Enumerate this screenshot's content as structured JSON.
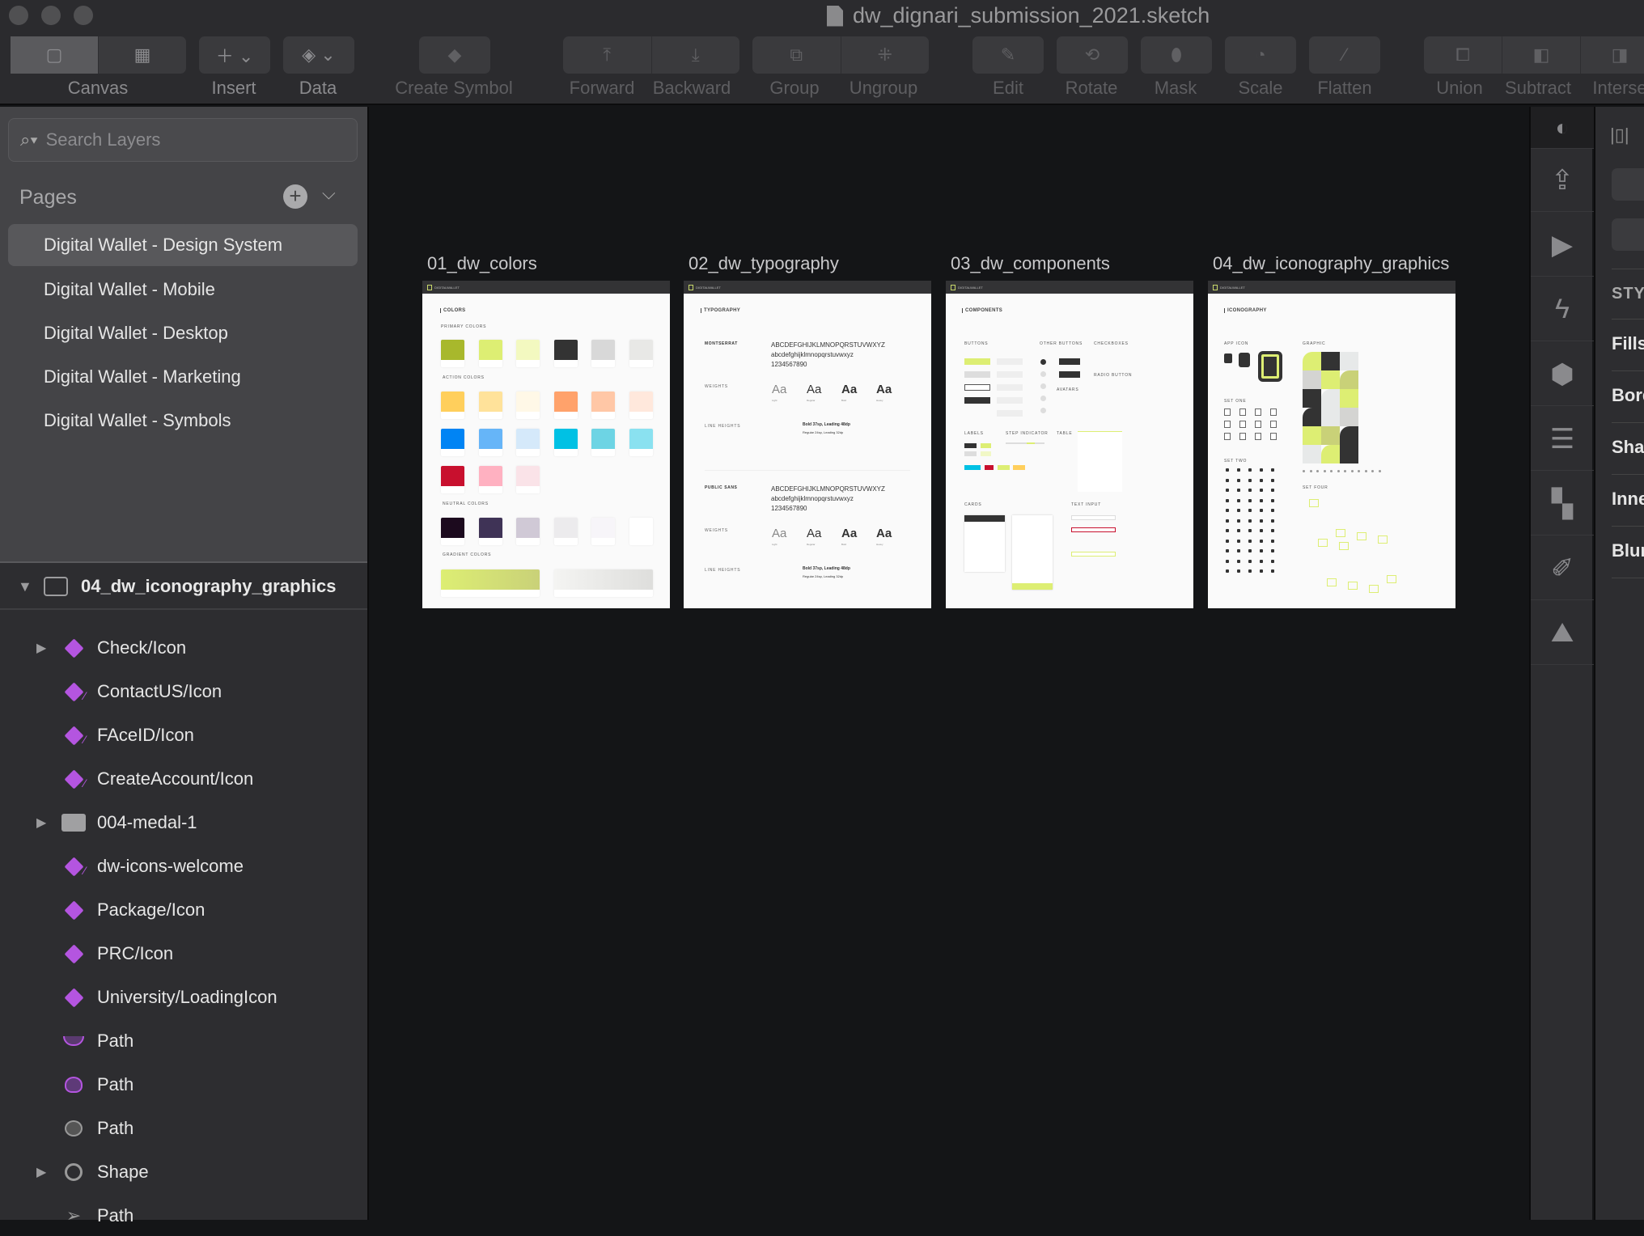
{
  "window": {
    "title": "dw_dignari_submission_2021.sketch"
  },
  "toolbar": {
    "canvas": "Canvas",
    "insert": "Insert",
    "data": "Data",
    "create_symbol": "Create Symbol",
    "forward": "Forward",
    "backward": "Backward",
    "group": "Group",
    "ungroup": "Ungroup",
    "edit": "Edit",
    "rotate": "Rotate",
    "mask": "Mask",
    "scale": "Scale",
    "flatten": "Flatten",
    "union": "Union",
    "subtract": "Subtract",
    "intersect": "Interse"
  },
  "sidebar": {
    "search_placeholder": "Search Layers",
    "pages_title": "Pages",
    "pages": [
      {
        "label": "Digital Wallet - Design System",
        "selected": true
      },
      {
        "label": "Digital Wallet - Mobile"
      },
      {
        "label": "Digital Wallet - Desktop"
      },
      {
        "label": "Digital Wallet - Marketing"
      },
      {
        "label": "Digital Wallet - Symbols"
      }
    ],
    "group": {
      "label": "04_dw_iconography_graphics",
      "expanded": true
    },
    "layers": [
      {
        "label": "Check/Icon",
        "icon": "symbol-icon",
        "expandable": true
      },
      {
        "label": "ContactUS/Icon",
        "icon": "symbol-edit-icon"
      },
      {
        "label": "FAceID/Icon",
        "icon": "symbol-edit-icon"
      },
      {
        "label": "CreateAccount/Icon",
        "icon": "symbol-edit-icon"
      },
      {
        "label": "004-medal-1",
        "icon": "folder-icon",
        "expandable": true
      },
      {
        "label": "dw-icons-welcome",
        "icon": "symbol-edit-icon"
      },
      {
        "label": "Package/Icon",
        "icon": "symbol-icon"
      },
      {
        "label": "PRC/Icon",
        "icon": "symbol-icon"
      },
      {
        "label": "University/LoadingIcon",
        "icon": "symbol-icon"
      },
      {
        "label": "Path",
        "icon": "path-arc-icon"
      },
      {
        "label": "Path",
        "icon": "path-purple-icon"
      },
      {
        "label": "Path",
        "icon": "path-gray-icon"
      },
      {
        "label": "Shape",
        "icon": "shape-icon",
        "expandable": true
      },
      {
        "label": "Path",
        "icon": "path-send-icon"
      }
    ]
  },
  "artboards": [
    {
      "title": "01_dw_colors",
      "brand": "DIGITALWALLET",
      "heading": "COLORS",
      "sections": [
        "PRIMARY COLORS",
        "ACTION COLORS",
        "NEUTRAL COLORS",
        "GRADIENT COLORS"
      ],
      "primary": [
        "#A8B82C",
        "#DDEE73",
        "#F3F9C0",
        "#333333",
        "#D8D8D8",
        "#E8E8E6"
      ],
      "action": [
        [
          "#FFCF5C",
          "#FFE29A",
          "#FFF8E7",
          "#FFA26B",
          "#FFC7A6",
          "#FFE8DC"
        ],
        [
          "#0084F4",
          "#66B5F8",
          "#D5E9FA",
          "#00C1E4",
          "#6DD4E4",
          "#8AE1F0"
        ],
        [
          "#C8102E",
          "#FFB1C1",
          "#FAE3E8"
        ]
      ],
      "neutral": [
        "#1C0A1E",
        "#3F3356",
        "#D0C9D6",
        "#ECEBED",
        "#F7F5F9",
        "#FFFFFF"
      ],
      "gradients": [
        [
          "#DDEE73",
          "#C9D178"
        ],
        [
          "#F4F4F2",
          "#DEDEDC"
        ]
      ]
    },
    {
      "title": "02_dw_typography",
      "brand": "DIGITALWALLET",
      "heading": "TYPOGRAPHY",
      "fonts": [
        {
          "name": "MONTSERRAT"
        },
        {
          "name": "PUBLIC SANS"
        }
      ],
      "upper": "ABCDEFGHIJKLMNOPQRSTUVWXYZ",
      "lower": "abcdefghijklmnopqrstuvwxyz",
      "digits": "1234567890",
      "weights_label": "WEIGHTS",
      "line_heights_label": "LINE HEIGHTS",
      "sample": "Aa",
      "weights": [
        "Light",
        "Regular",
        "Bold",
        "Heavy"
      ],
      "lines": [
        "Bold 37sp, Leading 48dp",
        "Regular 24sp, Leading 32dp"
      ]
    },
    {
      "title": "03_dw_components",
      "brand": "DIGITALWALLET",
      "heading": "COMPONENTS",
      "sections": [
        "BUTTONS",
        "OTHER BUTTONS",
        "CHECKBOXES",
        "RADIO BUTTON",
        "AVATARS",
        "LABELS",
        "STEP INDICATOR",
        "TABLE",
        "CARDS",
        "TEXT INPUT"
      ]
    },
    {
      "title": "04_dw_iconography_graphics",
      "brand": "DIGITALWALLET",
      "heading": "ICONOGRAPHY",
      "sections": [
        "APP ICON",
        "GRAPHIC",
        "SET ONE",
        "SET TWO",
        "SET THREE",
        "SET FOUR"
      ]
    }
  ],
  "inspector": {
    "style_label": "STY",
    "rows": [
      "Fills",
      "Bord",
      "Sha",
      "Inne",
      "Blur"
    ]
  },
  "colors": {
    "accent_symbol": "#B455E0",
    "brand_lime": "#DDEE73"
  }
}
